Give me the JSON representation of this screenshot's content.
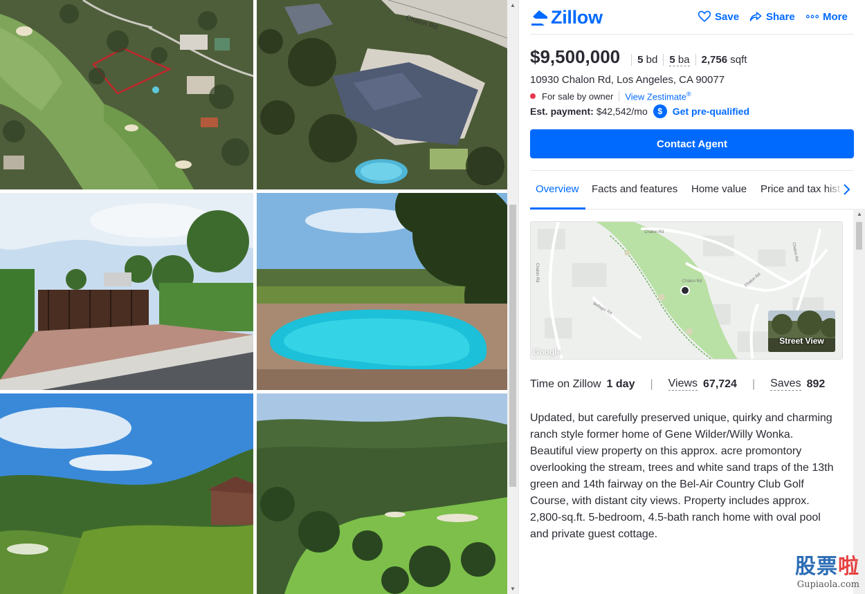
{
  "header": {
    "logo": "Zillow",
    "save": "Save",
    "share": "Share",
    "more": "More"
  },
  "listing": {
    "price": "$9,500,000",
    "beds_value": "5",
    "beds_unit": "bd",
    "baths_value": "5",
    "baths_unit": "ba",
    "sqft_value": "2,756",
    "sqft_unit": "sqft",
    "address": "10930 Chalon Rd, Los Angeles, CA 90077",
    "status": "For sale by owner",
    "zestimate_link": "View Zestimate",
    "payment_label": "Est. payment:",
    "payment_value": "$42,542/mo",
    "prequalified": "Get pre-qualified",
    "contact_button": "Contact Agent"
  },
  "tabs": [
    "Overview",
    "Facts and features",
    "Home value",
    "Price and tax hist"
  ],
  "map": {
    "street_view": "Street View",
    "google": "Google"
  },
  "stats": {
    "time_label": "Time on Zillow",
    "time_value": "1 day",
    "views_label": "Views",
    "views_value": "67,724",
    "saves_label": "Saves",
    "saves_value": "892"
  },
  "description": "Updated, but carefully preserved unique, quirky and charming ranch style former home of Gene Wilder/Willy Wonka. Beautiful view property on this approx. acre promontory overlooking the stream, trees and white sand traps of the 13th green and 14th fairway on the Bel-Air Country Club Golf Course, with distant city views. Property includes approx. 2,800-sq.ft. 5-bedroom, 4.5-bath ranch home with oval pool and private guest cottage.",
  "watermark": {
    "cn_a": "股票",
    "cn_b": "啦",
    "url": "Gupiaola.com"
  },
  "colors": {
    "brand": "#006aff",
    "status_dot": "#e8384f",
    "text": "#2a2a33"
  }
}
